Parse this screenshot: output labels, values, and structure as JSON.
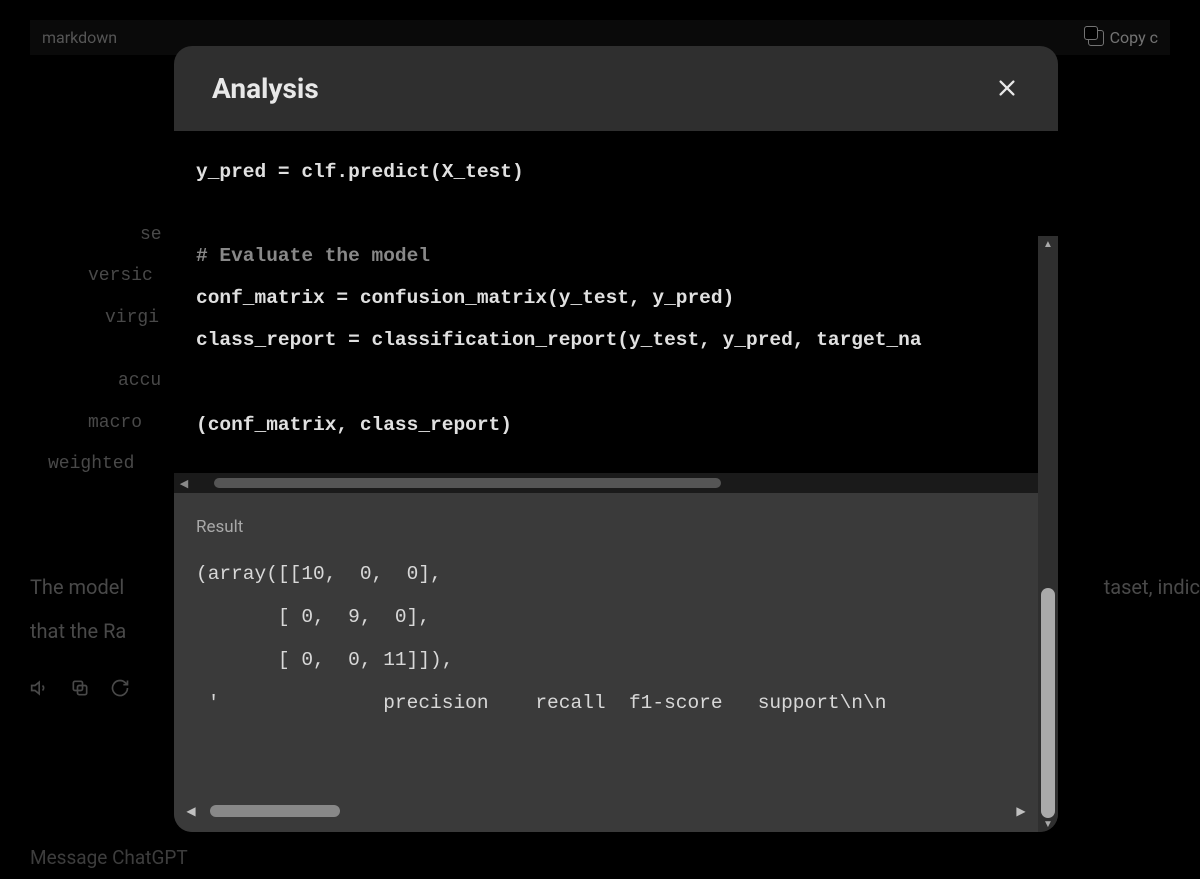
{
  "background": {
    "markdown_label": "markdown",
    "copy_label": "Copy c",
    "code_lines": {
      "l1": "se",
      "l2": "versic",
      "l3": "virgi",
      "l4": "accu",
      "l5": "macro",
      "l6": "weighted"
    },
    "body_text_1": "The model",
    "body_text_1_right": "taset, indic",
    "body_text_2": "that the Ra",
    "message_placeholder": "Message ChatGPT"
  },
  "modal": {
    "title": "Analysis",
    "code": {
      "line1": "y_pred = clf.predict(X_test)",
      "line2": "",
      "line3_comment": "# Evaluate the model",
      "line4": "conf_matrix = confusion_matrix(y_test, y_pred)",
      "line5": "class_report = classification_report(y_test, y_pred, target_na",
      "line6": "",
      "line7": "(conf_matrix, class_report)"
    },
    "result": {
      "label": "Result",
      "line1": "(array([[10,  0,  0],",
      "line2": "       [ 0,  9,  0],",
      "line3": "       [ 0,  0, 11]]),",
      "line4": " '              precision    recall  f1-score   support\\n\\n"
    }
  }
}
